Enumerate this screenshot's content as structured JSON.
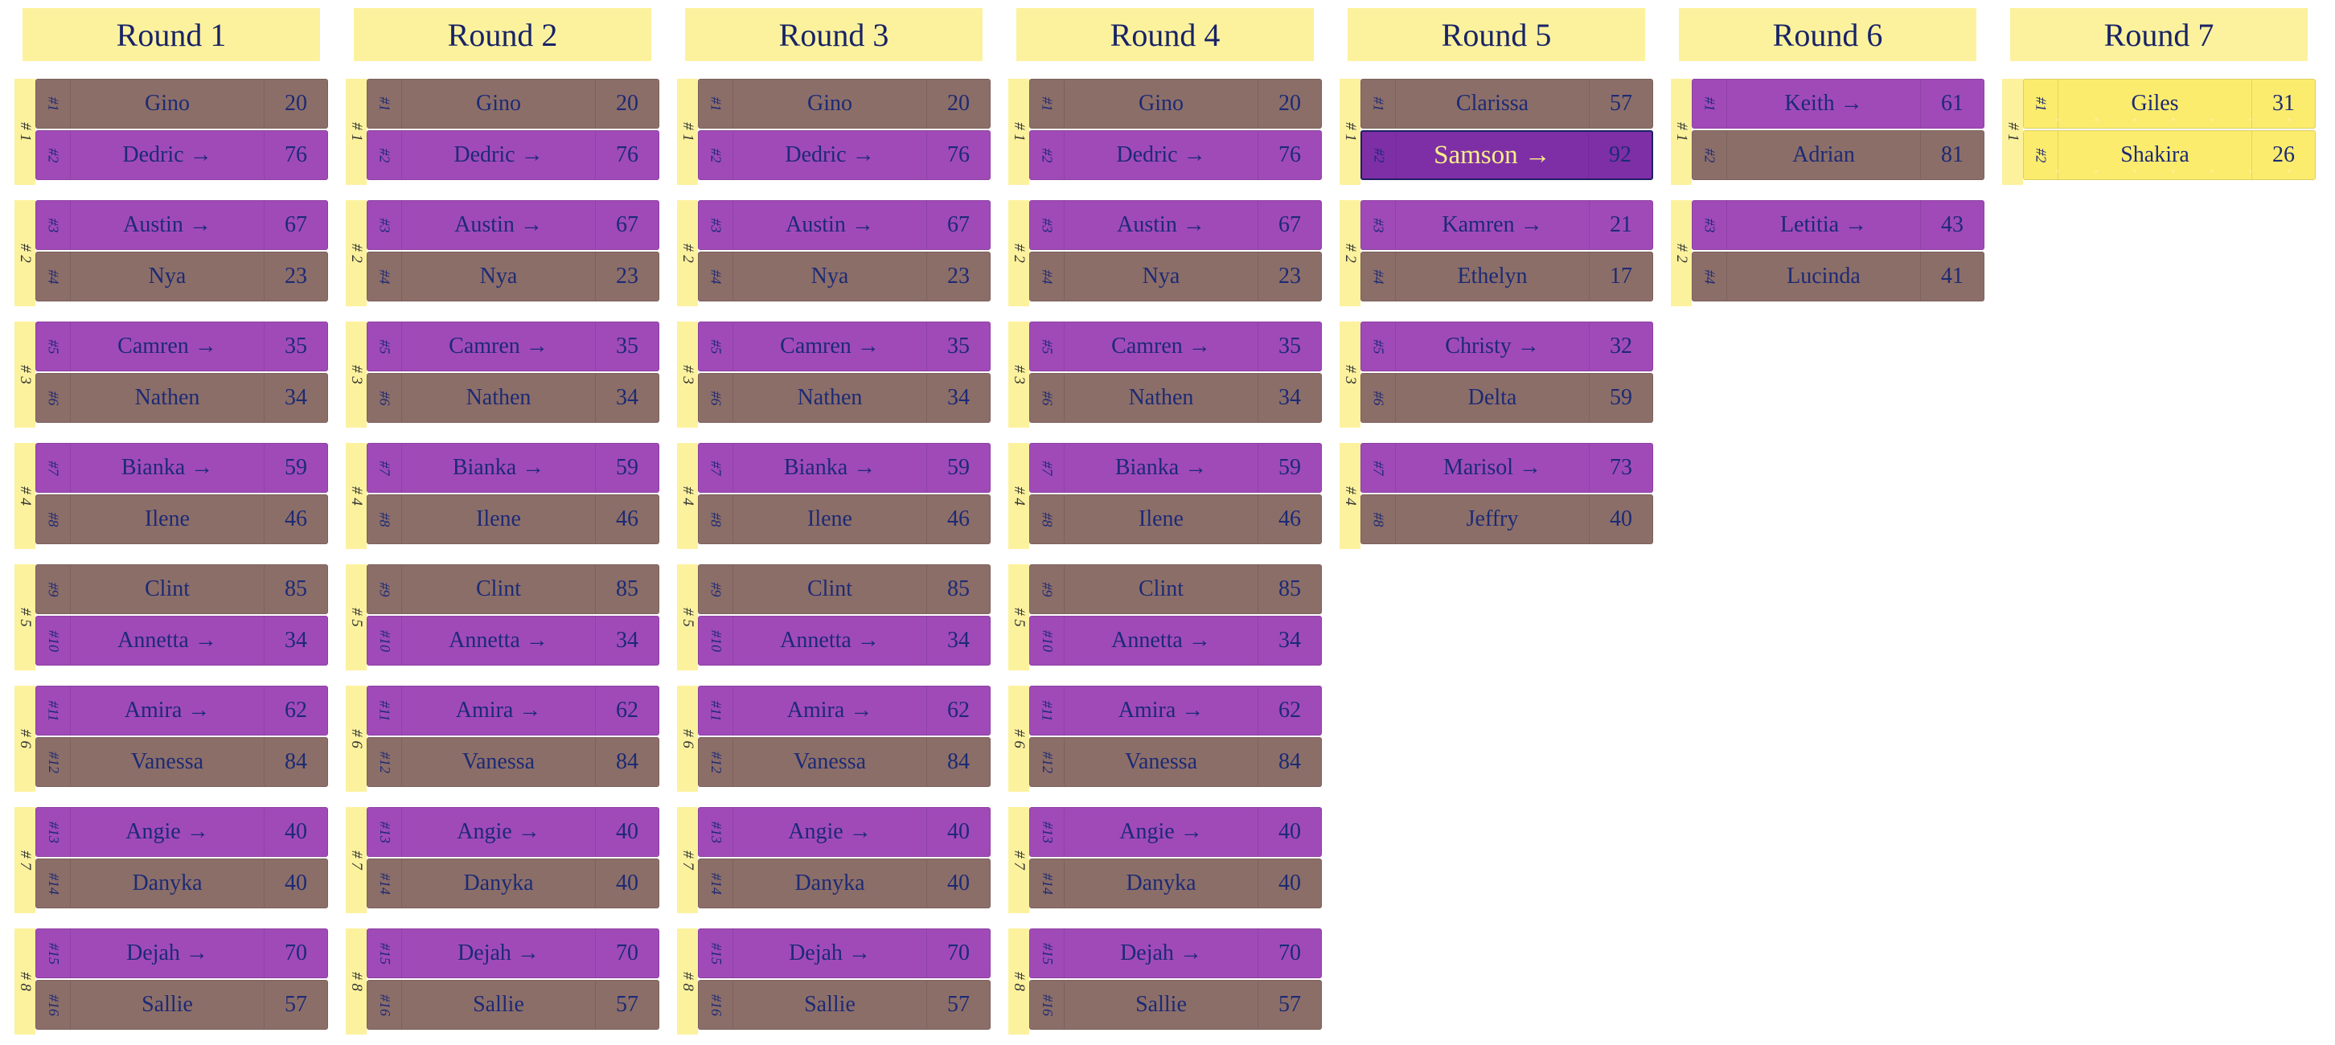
{
  "bracket": {
    "rounds": [
      {
        "title": "Round 1",
        "matches": [
          {
            "label": "# 1",
            "players": [
              {
                "seed": "#1",
                "name": "Gino",
                "score": "20",
                "winner": false
              },
              {
                "seed": "#2",
                "name": "Dedric →",
                "score": "76",
                "winner": true
              }
            ]
          },
          {
            "label": "# 2",
            "players": [
              {
                "seed": "#3",
                "name": "Austin →",
                "score": "67",
                "winner": true
              },
              {
                "seed": "#4",
                "name": "Nya",
                "score": "23",
                "winner": false
              }
            ]
          },
          {
            "label": "# 3",
            "players": [
              {
                "seed": "#5",
                "name": "Camren →",
                "score": "35",
                "winner": true
              },
              {
                "seed": "#6",
                "name": "Nathen",
                "score": "34",
                "winner": false
              }
            ]
          },
          {
            "label": "# 4",
            "players": [
              {
                "seed": "#7",
                "name": "Bianka →",
                "score": "59",
                "winner": true
              },
              {
                "seed": "#8",
                "name": "Ilene",
                "score": "46",
                "winner": false
              }
            ]
          },
          {
            "label": "# 5",
            "players": [
              {
                "seed": "#9",
                "name": "Clint",
                "score": "85",
                "winner": false
              },
              {
                "seed": "#10",
                "name": "Annetta →",
                "score": "34",
                "winner": true
              }
            ]
          },
          {
            "label": "# 6",
            "players": [
              {
                "seed": "#11",
                "name": "Amira →",
                "score": "62",
                "winner": true
              },
              {
                "seed": "#12",
                "name": "Vanessa",
                "score": "84",
                "winner": false
              }
            ]
          },
          {
            "label": "# 7",
            "players": [
              {
                "seed": "#13",
                "name": "Angie →",
                "score": "40",
                "winner": true
              },
              {
                "seed": "#14",
                "name": "Danyka",
                "score": "40",
                "winner": false
              }
            ]
          },
          {
            "label": "# 8",
            "players": [
              {
                "seed": "#15",
                "name": "Dejah →",
                "score": "70",
                "winner": true
              },
              {
                "seed": "#16",
                "name": "Sallie",
                "score": "57",
                "winner": false
              }
            ]
          }
        ]
      },
      {
        "title": "Round 2",
        "matches": [
          {
            "label": "# 1",
            "players": [
              {
                "seed": "#1",
                "name": "Gino",
                "score": "20",
                "winner": false
              },
              {
                "seed": "#2",
                "name": "Dedric →",
                "score": "76",
                "winner": true
              }
            ]
          },
          {
            "label": "# 2",
            "players": [
              {
                "seed": "#3",
                "name": "Austin →",
                "score": "67",
                "winner": true
              },
              {
                "seed": "#4",
                "name": "Nya",
                "score": "23",
                "winner": false
              }
            ]
          },
          {
            "label": "# 3",
            "players": [
              {
                "seed": "#5",
                "name": "Camren →",
                "score": "35",
                "winner": true
              },
              {
                "seed": "#6",
                "name": "Nathen",
                "score": "34",
                "winner": false
              }
            ]
          },
          {
            "label": "# 4",
            "players": [
              {
                "seed": "#7",
                "name": "Bianka →",
                "score": "59",
                "winner": true
              },
              {
                "seed": "#8",
                "name": "Ilene",
                "score": "46",
                "winner": false
              }
            ]
          },
          {
            "label": "# 5",
            "players": [
              {
                "seed": "#9",
                "name": "Clint",
                "score": "85",
                "winner": false
              },
              {
                "seed": "#10",
                "name": "Annetta →",
                "score": "34",
                "winner": true
              }
            ]
          },
          {
            "label": "# 6",
            "players": [
              {
                "seed": "#11",
                "name": "Amira →",
                "score": "62",
                "winner": true
              },
              {
                "seed": "#12",
                "name": "Vanessa",
                "score": "84",
                "winner": false
              }
            ]
          },
          {
            "label": "# 7",
            "players": [
              {
                "seed": "#13",
                "name": "Angie →",
                "score": "40",
                "winner": true
              },
              {
                "seed": "#14",
                "name": "Danyka",
                "score": "40",
                "winner": false
              }
            ]
          },
          {
            "label": "# 8",
            "players": [
              {
                "seed": "#15",
                "name": "Dejah →",
                "score": "70",
                "winner": true
              },
              {
                "seed": "#16",
                "name": "Sallie",
                "score": "57",
                "winner": false
              }
            ]
          }
        ]
      },
      {
        "title": "Round 3",
        "matches": [
          {
            "label": "# 1",
            "players": [
              {
                "seed": "#1",
                "name": "Gino",
                "score": "20",
                "winner": false
              },
              {
                "seed": "#2",
                "name": "Dedric →",
                "score": "76",
                "winner": true
              }
            ]
          },
          {
            "label": "# 2",
            "players": [
              {
                "seed": "#3",
                "name": "Austin →",
                "score": "67",
                "winner": true
              },
              {
                "seed": "#4",
                "name": "Nya",
                "score": "23",
                "winner": false
              }
            ]
          },
          {
            "label": "# 3",
            "players": [
              {
                "seed": "#5",
                "name": "Camren →",
                "score": "35",
                "winner": true
              },
              {
                "seed": "#6",
                "name": "Nathen",
                "score": "34",
                "winner": false
              }
            ]
          },
          {
            "label": "# 4",
            "players": [
              {
                "seed": "#7",
                "name": "Bianka →",
                "score": "59",
                "winner": true
              },
              {
                "seed": "#8",
                "name": "Ilene",
                "score": "46",
                "winner": false
              }
            ]
          },
          {
            "label": "# 5",
            "players": [
              {
                "seed": "#9",
                "name": "Clint",
                "score": "85",
                "winner": false
              },
              {
                "seed": "#10",
                "name": "Annetta →",
                "score": "34",
                "winner": true
              }
            ]
          },
          {
            "label": "# 6",
            "players": [
              {
                "seed": "#11",
                "name": "Amira →",
                "score": "62",
                "winner": true
              },
              {
                "seed": "#12",
                "name": "Vanessa",
                "score": "84",
                "winner": false
              }
            ]
          },
          {
            "label": "# 7",
            "players": [
              {
                "seed": "#13",
                "name": "Angie →",
                "score": "40",
                "winner": true
              },
              {
                "seed": "#14",
                "name": "Danyka",
                "score": "40",
                "winner": false
              }
            ]
          },
          {
            "label": "# 8",
            "players": [
              {
                "seed": "#15",
                "name": "Dejah →",
                "score": "70",
                "winner": true
              },
              {
                "seed": "#16",
                "name": "Sallie",
                "score": "57",
                "winner": false
              }
            ]
          }
        ]
      },
      {
        "title": "Round 4",
        "matches": [
          {
            "label": "# 1",
            "players": [
              {
                "seed": "#1",
                "name": "Gino",
                "score": "20",
                "winner": false
              },
              {
                "seed": "#2",
                "name": "Dedric →",
                "score": "76",
                "winner": true
              }
            ]
          },
          {
            "label": "# 2",
            "players": [
              {
                "seed": "#3",
                "name": "Austin →",
                "score": "67",
                "winner": true
              },
              {
                "seed": "#4",
                "name": "Nya",
                "score": "23",
                "winner": false
              }
            ]
          },
          {
            "label": "# 3",
            "players": [
              {
                "seed": "#5",
                "name": "Camren →",
                "score": "35",
                "winner": true
              },
              {
                "seed": "#6",
                "name": "Nathen",
                "score": "34",
                "winner": false
              }
            ]
          },
          {
            "label": "# 4",
            "players": [
              {
                "seed": "#7",
                "name": "Bianka →",
                "score": "59",
                "winner": true
              },
              {
                "seed": "#8",
                "name": "Ilene",
                "score": "46",
                "winner": false
              }
            ]
          },
          {
            "label": "# 5",
            "players": [
              {
                "seed": "#9",
                "name": "Clint",
                "score": "85",
                "winner": false
              },
              {
                "seed": "#10",
                "name": "Annetta →",
                "score": "34",
                "winner": true
              }
            ]
          },
          {
            "label": "# 6",
            "players": [
              {
                "seed": "#11",
                "name": "Amira →",
                "score": "62",
                "winner": true
              },
              {
                "seed": "#12",
                "name": "Vanessa",
                "score": "84",
                "winner": false
              }
            ]
          },
          {
            "label": "# 7",
            "players": [
              {
                "seed": "#13",
                "name": "Angie →",
                "score": "40",
                "winner": true
              },
              {
                "seed": "#14",
                "name": "Danyka",
                "score": "40",
                "winner": false
              }
            ]
          },
          {
            "label": "# 8",
            "players": [
              {
                "seed": "#15",
                "name": "Dejah →",
                "score": "70",
                "winner": true
              },
              {
                "seed": "#16",
                "name": "Sallie",
                "score": "57",
                "winner": false
              }
            ]
          }
        ]
      },
      {
        "title": "Round 5",
        "matches": [
          {
            "label": "# 1",
            "players": [
              {
                "seed": "#1",
                "name": "Clarissa",
                "score": "57",
                "winner": false
              },
              {
                "seed": "#2",
                "name": "Samson →",
                "score": "92",
                "winner": true,
                "selected": true
              }
            ]
          },
          {
            "label": "# 2",
            "players": [
              {
                "seed": "#3",
                "name": "Kamren →",
                "score": "21",
                "winner": true
              },
              {
                "seed": "#4",
                "name": "Ethelyn",
                "score": "17",
                "winner": false
              }
            ]
          },
          {
            "label": "# 3",
            "players": [
              {
                "seed": "#5",
                "name": "Christy →",
                "score": "32",
                "winner": true
              },
              {
                "seed": "#6",
                "name": "Delta",
                "score": "59",
                "winner": false
              }
            ]
          },
          {
            "label": "# 4",
            "players": [
              {
                "seed": "#7",
                "name": "Marisol →",
                "score": "73",
                "winner": true
              },
              {
                "seed": "#8",
                "name": "Jeffry",
                "score": "40",
                "winner": false
              }
            ]
          }
        ]
      },
      {
        "title": "Round 6",
        "matches": [
          {
            "label": "# 1",
            "players": [
              {
                "seed": "#1",
                "name": "Keith →",
                "score": "61",
                "winner": true
              },
              {
                "seed": "#2",
                "name": "Adrian",
                "score": "81",
                "winner": false
              }
            ]
          },
          {
            "label": "# 2",
            "players": [
              {
                "seed": "#3",
                "name": "Letitia →",
                "score": "43",
                "winner": true
              },
              {
                "seed": "#4",
                "name": "Lucinda",
                "score": "41",
                "winner": false
              }
            ]
          }
        ]
      },
      {
        "title": "Round 7",
        "final": true,
        "matches": [
          {
            "label": "# 1",
            "players": [
              {
                "seed": "#1",
                "name": "Giles",
                "score": "31",
                "winner": false
              },
              {
                "seed": "#2",
                "name": "Shakira",
                "score": "26",
                "winner": false
              }
            ]
          }
        ]
      }
    ]
  },
  "colors": {
    "header_bg": "#fcf29e",
    "winner_bg": "#a04ab8",
    "loser_bg": "#8c6e68",
    "selected_bg": "#7e2fa6",
    "final_bg": "#fcec6e",
    "text": "#1c2a75"
  }
}
